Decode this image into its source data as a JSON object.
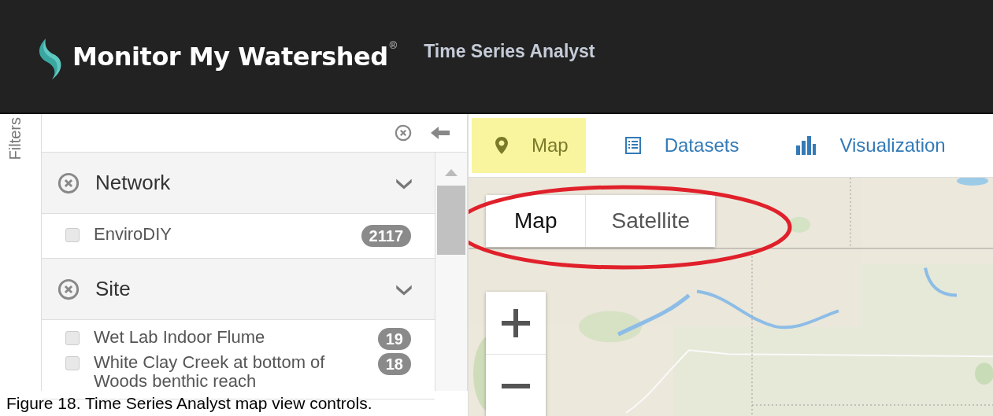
{
  "header": {
    "logo_text": "Monitor My Watershed",
    "registered_mark": "®",
    "app_title": "Time Series Analyst"
  },
  "filters_label": "Filters",
  "filter_groups": [
    {
      "title": "Network",
      "expanded": true,
      "items": [
        {
          "label": "EnviroDIY",
          "count": "2117",
          "checked": false
        }
      ]
    },
    {
      "title": "Site",
      "expanded": true,
      "items": [
        {
          "label": "Wet Lab Indoor Flume",
          "count": "19",
          "checked": false
        },
        {
          "label": "White Clay Creek at bottom of Woods benthic reach",
          "count": "18",
          "checked": false
        }
      ]
    }
  ],
  "tabs": [
    {
      "label": "Map",
      "kind": "pin",
      "selected": true
    },
    {
      "label": "Datasets",
      "kind": "list",
      "selected": false
    },
    {
      "label": "Visualization",
      "kind": "bars",
      "selected": false
    }
  ],
  "map_type": [
    {
      "label": "Map",
      "selected": true
    },
    {
      "label": "Satellite",
      "selected": false
    }
  ],
  "caption": "Figure 18. Time Series Analyst map view controls."
}
